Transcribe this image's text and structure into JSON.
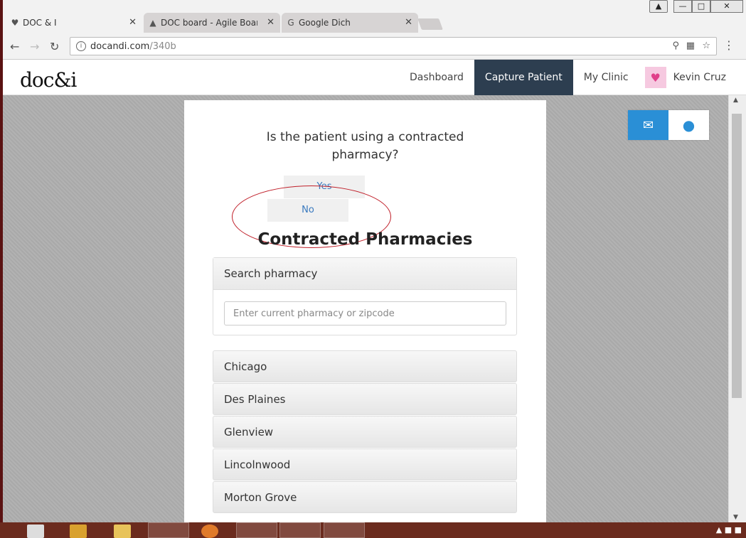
{
  "browser": {
    "tabs": [
      {
        "title": "DOC & I",
        "icon": "docandi-favicon",
        "active": true
      },
      {
        "title": "DOC board - Agile Board",
        "icon": "jira-favicon",
        "active": false
      },
      {
        "title": "Google Dich",
        "icon": "google-translate-favicon",
        "active": false
      }
    ],
    "url_host": "docandi.com",
    "url_path": "/340b"
  },
  "header": {
    "logo": "doc&i",
    "nav": [
      "Dashboard",
      "Capture Patient",
      "My Clinic"
    ],
    "active_nav": "Capture Patient",
    "user_name": "Kevin Cruz"
  },
  "form": {
    "question_line1": "Is the patient using a contracted",
    "question_line2": "pharmacy?",
    "yes_label": "Yes",
    "no_label": "No",
    "section_title": "Contracted Pharmacies",
    "search_heading": "Search pharmacy",
    "search_placeholder": "Enter current pharmacy or zipcode",
    "search_value": ""
  },
  "cities": [
    "Chicago",
    "Des Plaines",
    "Glenview",
    "Lincolnwood",
    "Morton Grove"
  ],
  "widgets": {
    "chat_icon": "chat-bubble-icon",
    "location_icon": "map-pin-icon"
  },
  "colors": {
    "nav_active": "#2d3e50",
    "accent": "#2a8fd6",
    "annotation": "#c0202a"
  }
}
